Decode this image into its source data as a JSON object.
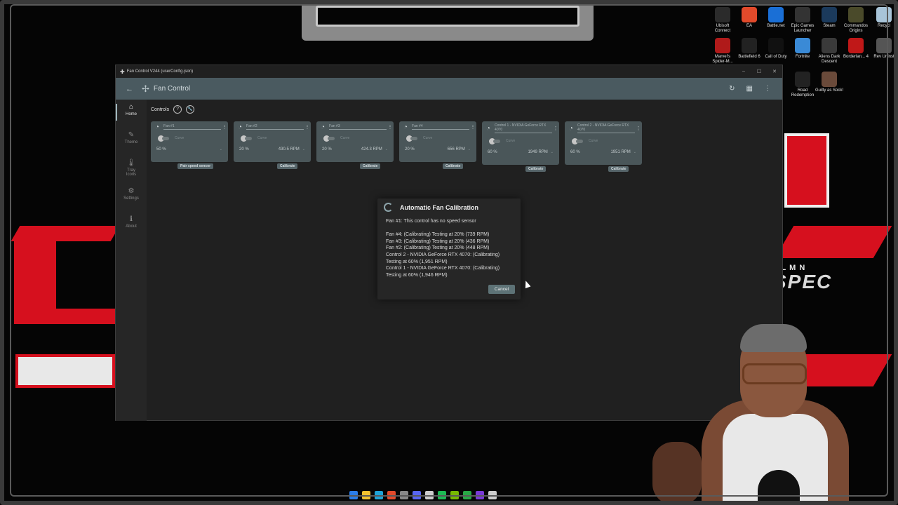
{
  "window": {
    "title": "Fan Control V244 (userConfig.json)",
    "minimize": "–",
    "maximize": "☐",
    "close": "✕"
  },
  "header": {
    "back": "←",
    "app_name": "Fan Control",
    "refresh": "↻",
    "layout": "▦",
    "more": "⋮"
  },
  "sidebar": {
    "items": [
      {
        "icon": "⌂",
        "label": "Home"
      },
      {
        "icon": "✎",
        "label": "Theme"
      },
      {
        "icon": "🌡",
        "label": "Tray Icons"
      },
      {
        "icon": "⚙",
        "label": "Settings"
      },
      {
        "icon": "ℹ",
        "label": "About"
      }
    ]
  },
  "controls": {
    "title": "Controls",
    "help_icon": "?",
    "wrench_icon": "🔧",
    "cards": [
      {
        "name": "Fan #1",
        "toggle": "Curve",
        "percent": "50 %",
        "rpm": "",
        "button": "Pair speed sensor"
      },
      {
        "name": "Fan #2",
        "toggle": "Curve",
        "percent": "20 %",
        "rpm": "430.5 RPM",
        "button": "Calibrate"
      },
      {
        "name": "Fan #3",
        "toggle": "Curve",
        "percent": "20 %",
        "rpm": "424.3 RPM",
        "button": "Calibrate"
      },
      {
        "name": "Fan #4",
        "toggle": "Curve",
        "percent": "20 %",
        "rpm": "656 RPM",
        "button": "Calibrate"
      },
      {
        "name": "Control 1 - NVIDIA GeForce RTX 4070",
        "toggle": "Curve",
        "percent": "60 %",
        "rpm": "1949 RPM",
        "button": "Calibrate"
      },
      {
        "name": "Control 2 - NVIDIA GeForce RTX 4070",
        "toggle": "Curve",
        "percent": "60 %",
        "rpm": "1951 RPM",
        "button": "Calibrate"
      }
    ]
  },
  "dialog": {
    "title": "Automatic Fan Calibration",
    "lines": [
      "Fan #1: This control has no speed sensor",
      "",
      "Fan #4: (Calibrating) Testing at 20% (739 RPM)",
      "Fan #3: (Calibrating) Testing at 20% (436 RPM)",
      "Fan #2: (Calibrating) Testing at 20% (448 RPM)",
      "Control 2 - NVIDIA GeForce RTX 4070: (Calibrating)",
      "Testing at 60% (1,951 RPM)",
      "Control 1 - NVIDIA GeForce RTX 4070: (Calibrating)",
      "Testing at 60% (1,946 RPM)"
    ],
    "cancel": "Cancel"
  },
  "desktop_icons": [
    {
      "label": "Ubisoft Connect",
      "color": "#2b2b2b"
    },
    {
      "label": "EA",
      "color": "#e24a2b"
    },
    {
      "label": "Battle.net",
      "color": "#1a6fd6"
    },
    {
      "label": "Epic Games Launcher",
      "color": "#333333"
    },
    {
      "label": "Steam",
      "color": "#1b3a5c"
    },
    {
      "label": "Commandos Origins",
      "color": "#4a4a2a"
    },
    {
      "label": "Recycl",
      "color": "#a8c4d8"
    },
    {
      "label": "Marvel's Spider-M...",
      "color": "#b01a1a"
    },
    {
      "label": "Battlefield 6",
      "color": "#222222"
    },
    {
      "label": "Call of Duty",
      "color": "#111111"
    },
    {
      "label": "Fortnite",
      "color": "#3a8ad6"
    },
    {
      "label": "Aliens Dark Descent",
      "color": "#3a3a3a"
    },
    {
      "label": "Borderlan... 4",
      "color": "#c01818"
    },
    {
      "label": "Rev Uninst",
      "color": "#555555"
    },
    {
      "label": "Road Redemption",
      "color": "#222222"
    },
    {
      "label": "Guilty as Sock!",
      "color": "#6a4a3a"
    }
  ],
  "overlay_logo": {
    "top": "OL M N",
    "bottom": "SPEC"
  },
  "taskbar_colors": [
    "#2b7de9",
    "#f2c230",
    "#1fa3d6",
    "#e24a2b",
    "#888888",
    "#5865f2",
    "#cccccc",
    "#1db954",
    "#76b900",
    "#28a745",
    "#7a3ad6",
    "#cccccc"
  ]
}
